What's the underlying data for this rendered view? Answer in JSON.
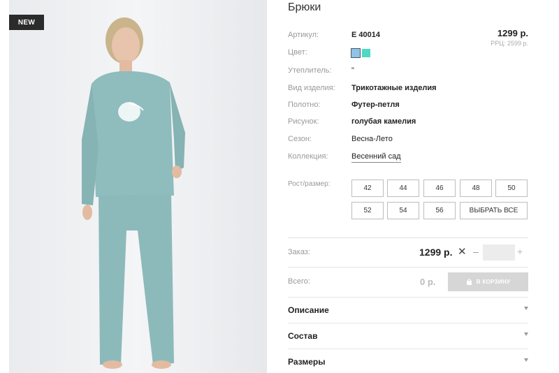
{
  "product": {
    "badge": "NEW",
    "title": "Брюки",
    "image_description_icon": "product-photo",
    "price": "1299 р.",
    "rrp": "РРЦ: 2599 р."
  },
  "attributes": [
    {
      "label": "Артикул:",
      "value": "Е 40014",
      "style": "bold"
    },
    {
      "label": "Цвет:",
      "value": "",
      "style": "swatch"
    },
    {
      "label": "Утеплитель:",
      "value": "\"",
      "style": "normal"
    },
    {
      "label": "Вид изделия:",
      "value": "Трикотажные изделия",
      "style": "bold"
    },
    {
      "label": "Полотно:",
      "value": "Футер-петля",
      "style": "bold"
    },
    {
      "label": "Рисунок:",
      "value": "голубая камелия",
      "style": "bold"
    },
    {
      "label": "Сезон:",
      "value": "Весна-Лето",
      "style": "normal"
    },
    {
      "label": "Коллекция:",
      "value": "Весенний сад",
      "style": "link"
    }
  ],
  "colors": [
    {
      "name": "light-blue",
      "hex": "#8ec3ec",
      "selected": true
    },
    {
      "name": "turquoise",
      "hex": "#4fd8c4",
      "selected": false
    }
  ],
  "sizes": {
    "label": "Рост/размер:",
    "items": [
      "42",
      "44",
      "46",
      "48",
      "50",
      "52",
      "54",
      "56"
    ],
    "select_all": "ВЫБРАТЬ ВСЕ"
  },
  "order": {
    "label": "Заказ:",
    "price": "1299 р.",
    "times": "✕",
    "minus": "–",
    "plus": "+",
    "qty_value": ""
  },
  "total": {
    "label": "Всего:",
    "value": "0 р.",
    "cart_button": "В КОРЗИНУ"
  },
  "accordion": [
    {
      "title": "Описание"
    },
    {
      "title": "Состав"
    },
    {
      "title": "Размеры"
    }
  ],
  "colors_ui": {
    "photo_bg": "#eceef0",
    "garment": "#8fbcbc",
    "badge_bg": "#2b2b2b",
    "cart_bg": "#d6d6d6"
  }
}
